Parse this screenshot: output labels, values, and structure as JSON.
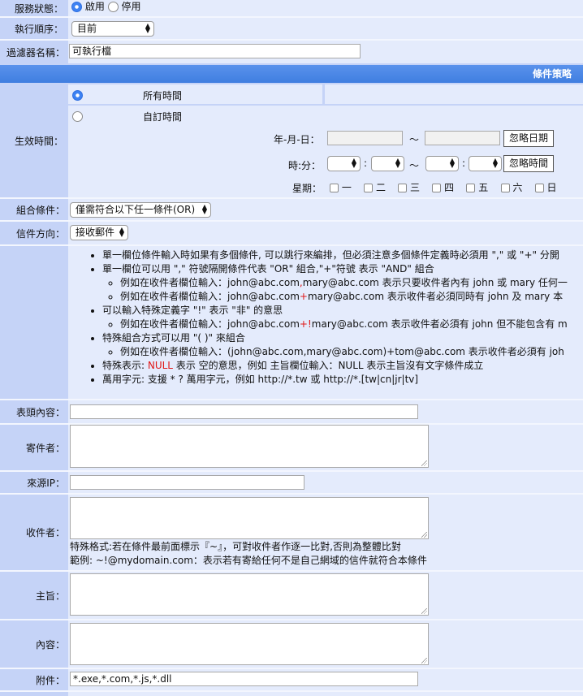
{
  "service_status": {
    "label": "服務狀態：",
    "enable": "啟用",
    "disable": "停用"
  },
  "exec_order": {
    "label": "執行順序：",
    "value": "目前"
  },
  "filter_name": {
    "label": "過濾器名稱：",
    "value": "可執行檔"
  },
  "section_title": "條件策略",
  "effective_time": {
    "label": "生效時間：",
    "all_time": "所有時間",
    "custom_time": "自訂時間",
    "date_label": "年-月-日：",
    "tilde": "～",
    "ignore_date": "忽略日期",
    "time_label": "時:分：",
    "colon": ":",
    "ignore_time": "忽略時間",
    "week_label": "星期：",
    "days": [
      "一",
      "二",
      "三",
      "四",
      "五",
      "六",
      "日"
    ]
  },
  "combine": {
    "label": "組合條件：",
    "value": "僅需符合以下任一條件(OR)"
  },
  "direction": {
    "label": "信件方向：",
    "value": "接收郵件"
  },
  "help": {
    "l1": "單一欄位條件輸入時如果有多個條件, 可以跳行來編排，但必須注意多個條件定義時必須用 \",\" 或 \"+\" 分開",
    "l2": "單一欄位可以用 \",\" 符號隔開條件代表 \"OR\" 組合,\"+\"符號 表示 \"AND\" 組合",
    "l2a_pre": "例如在收件者欄位輸入：john@abc.com",
    "l2a_op": ",",
    "l2a_post": "mary@abc.com 表示只要收件者內有 john 或 mary 任何一",
    "l2b_pre": "例如在收件者欄位輸入：john@abc.com",
    "l2b_op": "+",
    "l2b_post": "mary@abc.com 表示收件者必須同時有 john 及 mary 本",
    "l3": "可以輸入特殊定義字 \"!\" 表示 \"非\" 的意思",
    "l3a_pre": "例如在收件者欄位輸入：john@abc.com",
    "l3a_op": "+!",
    "l3a_post": "mary@abc.com 表示收件者必須有 john 但不能包含有 m",
    "l4": "特殊組合方式可以用 \"( )\" 來組合",
    "l4a": "例如在收件者欄位輸入：(john@abc.com,mary@abc.com)+tom@abc.com 表示收件者必須有 joh",
    "l5_pre": "特殊表示: ",
    "l5_null": "NULL",
    "l5_post": " 表示 空的意思，例如 主旨欄位輸入：NULL 表示主旨沒有文字條件成立",
    "l6": "萬用字元: 支援 * ? 萬用字元，例如 http://*.tw 或 http://*.[tw|cn|jr|tv]"
  },
  "header_content": {
    "label": "表頭內容：",
    "value": ""
  },
  "sender": {
    "label": "寄件者：",
    "value": ""
  },
  "source_ip": {
    "label": "來源IP：",
    "value": ""
  },
  "recipient": {
    "label": "收件者：",
    "note1": "特殊格式:若在條件最前面標示『~』，可對收件者作逐一比對,否則為整體比對",
    "note2": "範例: ~!@mydomain.com：表示若有寄給任何不是自己網域的信件就符合本條件"
  },
  "subject": {
    "label": "主旨："
  },
  "content": {
    "label": "內容："
  },
  "attachment": {
    "label": "附件：",
    "value": "*.exe,*.com,*.js,*.dll"
  }
}
